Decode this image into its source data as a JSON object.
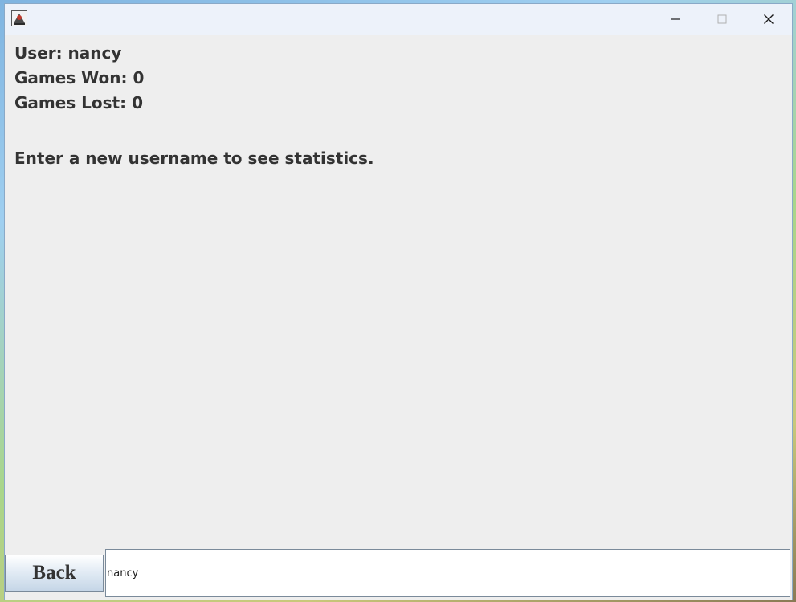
{
  "window": {
    "title": "",
    "controls": {
      "minimize_icon": "minimize-icon",
      "maximize_icon": "maximize-icon",
      "close_icon": "close-icon"
    }
  },
  "stats": {
    "user_line": "User: nancy",
    "won_line": "Games Won: 0",
    "lost_line": "Games Lost: 0",
    "prompt": "Enter a new username to see statistics."
  },
  "footer": {
    "back_label": "Back",
    "username_value": "nancy"
  },
  "colors": {
    "window_bg": "#eeeeee",
    "titlebar_bg": "#edf2fa",
    "text": "#333333"
  }
}
